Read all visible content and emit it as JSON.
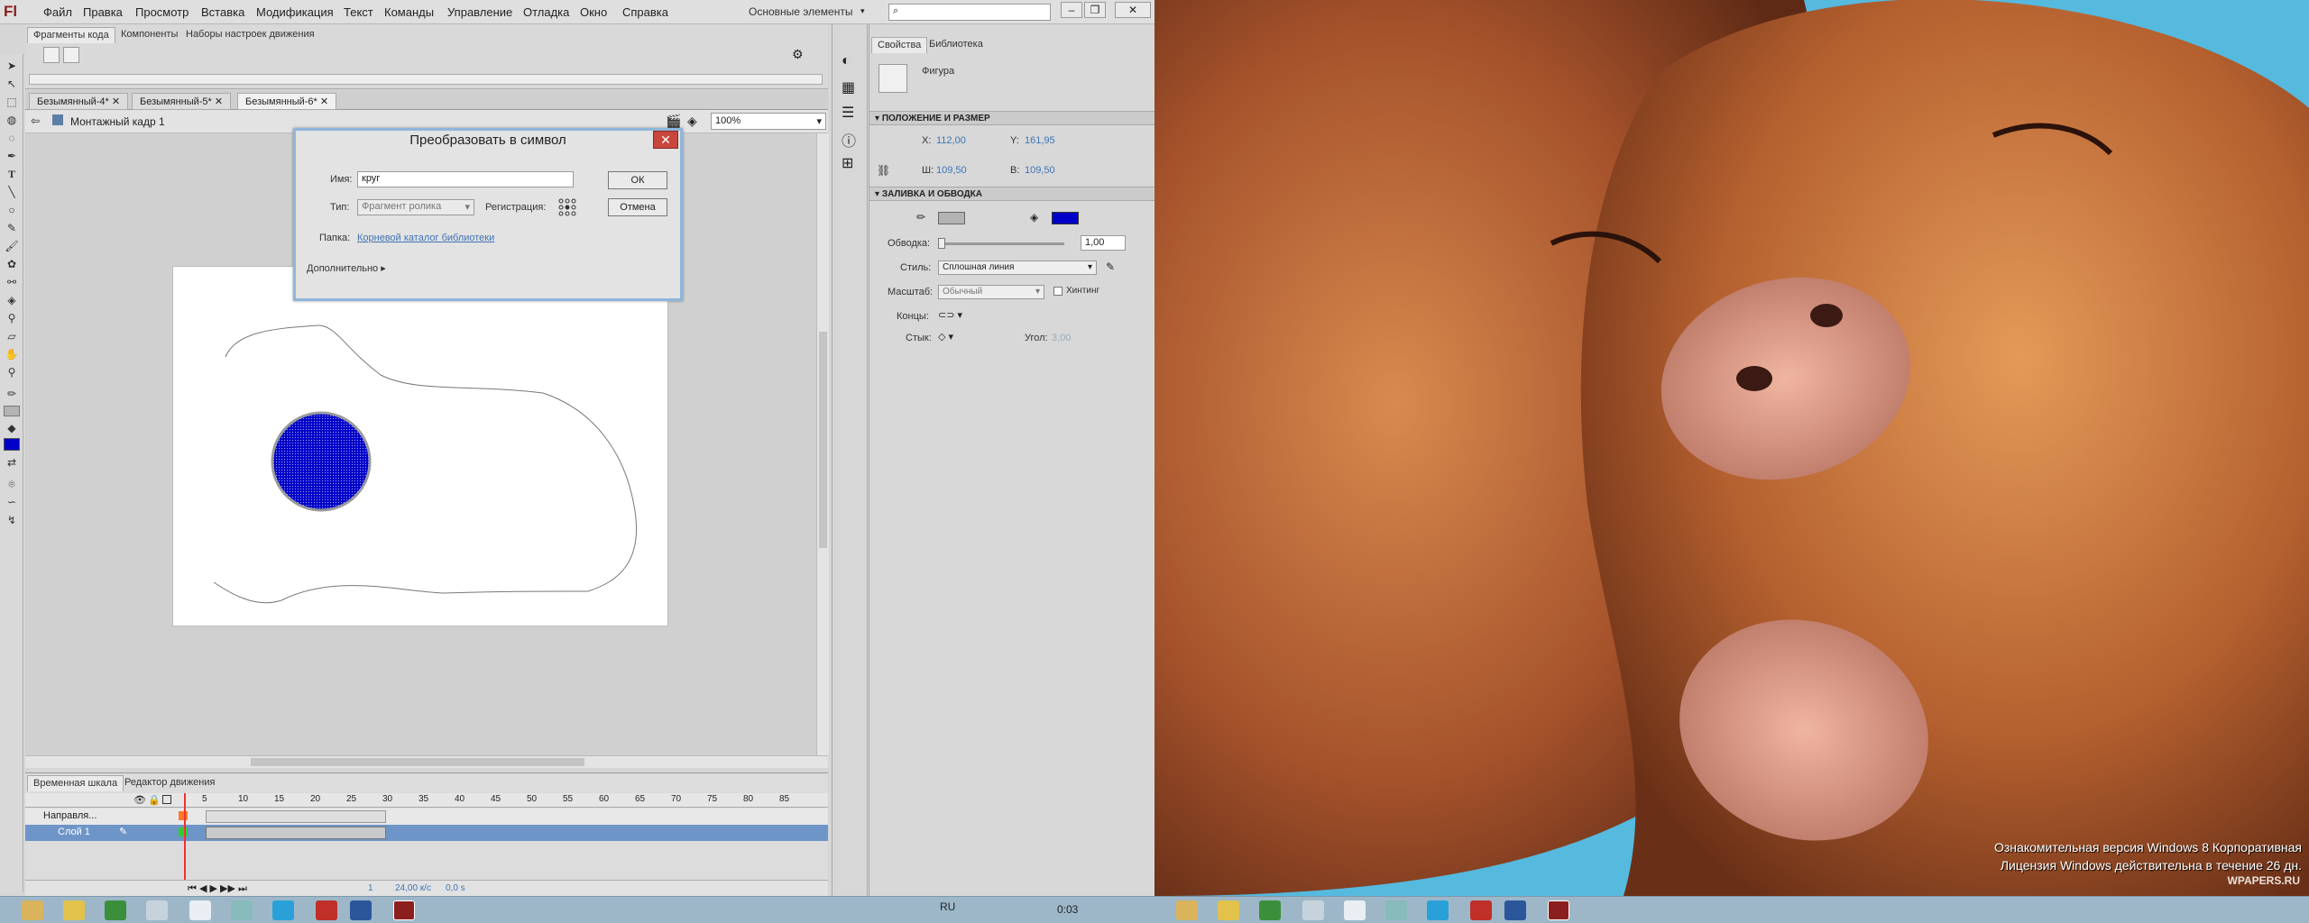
{
  "app": {
    "logo": "Fl",
    "menu": [
      "Файл",
      "Правка",
      "Просмотр",
      "Вставка",
      "Модификация",
      "Текст",
      "Команды",
      "Управление",
      "Отладка",
      "Окно",
      "Справка"
    ],
    "workspace": "Основные элементы",
    "search_placeholder": ""
  },
  "panels": {
    "top_tabs": [
      "Фрагменты кода",
      "Компоненты",
      "Наборы настроек движения"
    ],
    "doc_tabs": [
      "Безымянный-4*",
      "Безымянный-5*",
      "Безымянный-6*"
    ],
    "scene": "Монтажный кадр 1",
    "zoom": "100%"
  },
  "dialog": {
    "title": "Преобразовать в символ",
    "name_label": "Имя:",
    "name_value": "круг",
    "type_label": "Тип:",
    "type_value": "Фрагмент ролика",
    "reg_label": "Регистрация:",
    "folder_label": "Папка:",
    "folder_value": "Корневой каталог библиотеки",
    "advanced": "Дополнительно",
    "ok": "ОК",
    "cancel": "Отмена"
  },
  "timeline": {
    "tabs": [
      "Временная шкала",
      "Редактор движения"
    ],
    "frames": [
      "5",
      "10",
      "15",
      "20",
      "25",
      "30",
      "35",
      "40",
      "45",
      "50",
      "55",
      "60",
      "65",
      "70",
      "75",
      "80",
      "85"
    ],
    "layers": [
      "Направля...",
      "Слой 1"
    ],
    "status": {
      "frame": "1",
      "fps": "24,00 к/с",
      "time": "0,0 s"
    }
  },
  "properties": {
    "tabs": [
      "Свойства",
      "Библиотека"
    ],
    "object": "Фигура",
    "pos_section": "ПОЛОЖЕНИЕ И РАЗМЕР",
    "x_label": "X:",
    "x": "112,00",
    "y_label": "Y:",
    "y": "161,95",
    "w_label": "Ш:",
    "w": "109,50",
    "h_label": "В:",
    "h": "109,50",
    "fill_section": "ЗАЛИВКА И ОБВОДКА",
    "stroke_label": "Обводка:",
    "stroke": "1,00",
    "style_label": "Стиль:",
    "style": "Сплошная линия",
    "scale_label": "Масштаб:",
    "scale": "Обычный",
    "hinting": "Хинтинг",
    "caps_label": "Концы:",
    "join_label": "Стык:",
    "angle_label": "Угол:",
    "angle": "3,00",
    "stroke_color": "#b3b3b3",
    "fill_color": "#0000c8"
  },
  "watermark": {
    "line1": "Ознакомительная версия Windows 8 Корпоративная",
    "line2": "Лицензия Windows действительна в течение 26 дн.",
    "site": "WPAPERS.RU"
  },
  "taskbar": {
    "lang": "RU",
    "time": "0:03"
  }
}
